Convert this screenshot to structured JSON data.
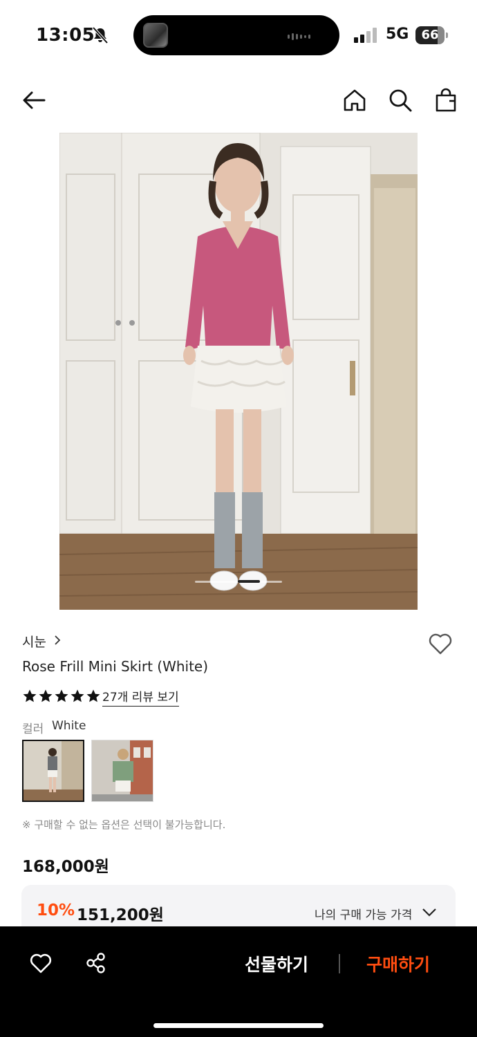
{
  "status": {
    "time": "13:05",
    "network": "5G",
    "battery": "66",
    "icons": [
      "bell-off-icon",
      "signal-icon",
      "battery-icon"
    ]
  },
  "nav": {
    "icons": [
      "back-arrow-icon",
      "home-icon",
      "search-icon",
      "shopping-bag-icon"
    ]
  },
  "product": {
    "brand": "시눈",
    "title": "Rose Frill Mini Skirt (White)",
    "rating_stars": 5,
    "review_link": "27개 리뷰 보기",
    "color_label": "컬러",
    "color_value": "White",
    "notice": "※ 구매할 수 없는 옵션은 선택이 불가능합니다.",
    "price": "168,000원",
    "sale": {
      "percent": "10%",
      "price": "151,200원",
      "my_price_label": "나의 구매 가능 가격"
    }
  },
  "image_pager": {
    "active_index": 1,
    "count": 2
  },
  "bottom_bar": {
    "gift_label": "선물하기",
    "buy_label": "구매하기",
    "icons": [
      "heart-icon",
      "share-icon"
    ]
  },
  "colors": {
    "accent": "#ff4d10",
    "bottom_bar_bg": "#000000",
    "sale_box_bg": "#f4f4f6"
  }
}
